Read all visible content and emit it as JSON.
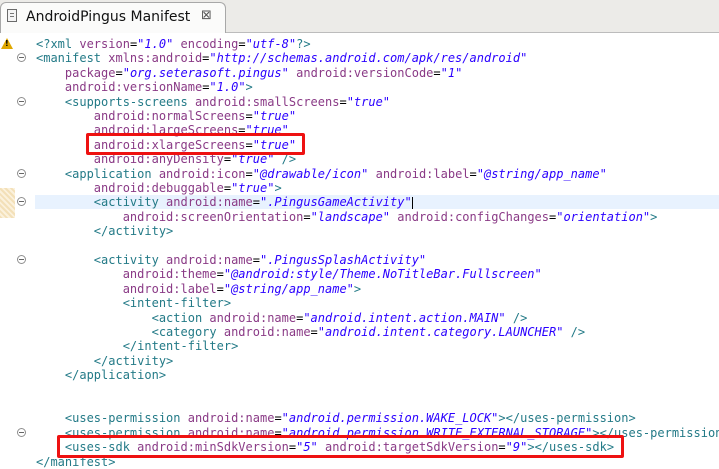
{
  "window": {
    "tab_title": "AndroidPingus Manifest",
    "close_glyph": "⊠"
  },
  "editor": {
    "lines": [
      [
        [
          "pi",
          "<?xml "
        ],
        [
          "attr",
          "version"
        ],
        [
          "eq",
          "="
        ],
        [
          "val",
          "\"1.0\""
        ],
        [
          "pi",
          " "
        ],
        [
          "attr",
          "encoding"
        ],
        [
          "eq",
          "="
        ],
        [
          "val",
          "\"utf-8\""
        ],
        [
          "pi",
          "?>"
        ]
      ],
      [
        [
          "tag",
          "<manifest "
        ],
        [
          "attr",
          "xmlns:android"
        ],
        [
          "eq",
          "="
        ],
        [
          "val",
          "\"http://schemas.android.com/apk/res/android\""
        ]
      ],
      [
        [
          "pad",
          "    "
        ],
        [
          "attr",
          "package"
        ],
        [
          "eq",
          "="
        ],
        [
          "val",
          "\"org.seterasoft.pingus\""
        ],
        [
          "pad",
          " "
        ],
        [
          "attr",
          "android:versionCode"
        ],
        [
          "eq",
          "="
        ],
        [
          "val",
          "\"1\""
        ]
      ],
      [
        [
          "pad",
          "    "
        ],
        [
          "attr",
          "android:versionName"
        ],
        [
          "eq",
          "="
        ],
        [
          "val",
          "\"1.0\""
        ],
        [
          "tag",
          ">"
        ]
      ],
      [
        [
          "pad",
          "    "
        ],
        [
          "tag",
          "<supports-screens "
        ],
        [
          "attr",
          "android:smallScreens"
        ],
        [
          "eq",
          "="
        ],
        [
          "val",
          "\"true\""
        ]
      ],
      [
        [
          "pad",
          "        "
        ],
        [
          "attr",
          "android:normalScreens"
        ],
        [
          "eq",
          "="
        ],
        [
          "val",
          "\"true\""
        ]
      ],
      [
        [
          "pad",
          "        "
        ],
        [
          "attr",
          "android:largeScreens"
        ],
        [
          "eq",
          "="
        ],
        [
          "val",
          "\"true\""
        ]
      ],
      [
        [
          "pad",
          "        "
        ],
        [
          "attr",
          "android:xlargeScreens"
        ],
        [
          "eq",
          "="
        ],
        [
          "val",
          "\"true\""
        ]
      ],
      [
        [
          "pad",
          "        "
        ],
        [
          "attr",
          "android:anyDensity"
        ],
        [
          "eq",
          "="
        ],
        [
          "val",
          "\"true\""
        ],
        [
          "tag",
          " />"
        ]
      ],
      [
        [
          "pad",
          "    "
        ],
        [
          "tag",
          "<application "
        ],
        [
          "attr",
          "android:icon"
        ],
        [
          "eq",
          "="
        ],
        [
          "val",
          "\"@drawable/icon\""
        ],
        [
          "pad",
          " "
        ],
        [
          "attr",
          "android:label"
        ],
        [
          "eq",
          "="
        ],
        [
          "val",
          "\"@string/app_name\""
        ]
      ],
      [
        [
          "pad",
          "        "
        ],
        [
          "attr",
          "android:debuggable"
        ],
        [
          "eq",
          "="
        ],
        [
          "val",
          "\"true\""
        ],
        [
          "tag",
          ">"
        ]
      ],
      [
        [
          "pad",
          "        "
        ],
        [
          "tag",
          "<activity "
        ],
        [
          "attr",
          "android:name"
        ],
        [
          "eq",
          "="
        ],
        [
          "val",
          "\".PingusGameActivity\""
        ]
      ],
      [
        [
          "pad",
          "            "
        ],
        [
          "attr",
          "android:screenOrientation"
        ],
        [
          "eq",
          "="
        ],
        [
          "val",
          "\"landscape\""
        ],
        [
          "pad",
          " "
        ],
        [
          "attr",
          "android:configChanges"
        ],
        [
          "eq",
          "="
        ],
        [
          "val",
          "\"orientation\""
        ],
        [
          "tag",
          ">"
        ]
      ],
      [
        [
          "pad",
          "        "
        ],
        [
          "tag",
          "</activity>"
        ]
      ],
      [],
      [
        [
          "pad",
          "        "
        ],
        [
          "tag",
          "<activity "
        ],
        [
          "attr",
          "android:name"
        ],
        [
          "eq",
          "="
        ],
        [
          "val",
          "\".PingusSplashActivity\""
        ]
      ],
      [
        [
          "pad",
          "            "
        ],
        [
          "attr",
          "android:theme"
        ],
        [
          "eq",
          "="
        ],
        [
          "val",
          "\"@android:style/Theme.NoTitleBar.Fullscreen\""
        ]
      ],
      [
        [
          "pad",
          "            "
        ],
        [
          "attr",
          "android:label"
        ],
        [
          "eq",
          "="
        ],
        [
          "val",
          "\"@string/app_name\""
        ],
        [
          "tag",
          ">"
        ]
      ],
      [
        [
          "pad",
          "            "
        ],
        [
          "tag",
          "<intent-filter>"
        ]
      ],
      [
        [
          "pad",
          "                "
        ],
        [
          "tag",
          "<action "
        ],
        [
          "attr",
          "android:name"
        ],
        [
          "eq",
          "="
        ],
        [
          "val",
          "\"android.intent.action.MAIN\""
        ],
        [
          "tag",
          " />"
        ]
      ],
      [
        [
          "pad",
          "                "
        ],
        [
          "tag",
          "<category "
        ],
        [
          "attr",
          "android:name"
        ],
        [
          "eq",
          "="
        ],
        [
          "val",
          "\"android.intent.category.LAUNCHER\""
        ],
        [
          "tag",
          " />"
        ]
      ],
      [
        [
          "pad",
          "            "
        ],
        [
          "tag",
          "</intent-filter>"
        ]
      ],
      [
        [
          "pad",
          "        "
        ],
        [
          "tag",
          "</activity>"
        ]
      ],
      [
        [
          "pad",
          "    "
        ],
        [
          "tag",
          "</application>"
        ]
      ],
      [],
      [],
      [
        [
          "pad",
          "    "
        ],
        [
          "tag",
          "<uses-permission "
        ],
        [
          "attr",
          "android:name"
        ],
        [
          "eq",
          "="
        ],
        [
          "val",
          "\"android.permission.WAKE_LOCK\""
        ],
        [
          "tag",
          "></uses-permission>"
        ]
      ],
      [
        [
          "pad",
          "    "
        ],
        [
          "tag",
          "<uses-permission "
        ],
        [
          "attr",
          "android:name"
        ],
        [
          "eq",
          "="
        ],
        [
          "val",
          "\"android.permission.WRITE_EXTERNAL_STORAGE\""
        ],
        [
          "tag",
          "></uses-permission>"
        ]
      ],
      [
        [
          "pad",
          "    "
        ],
        [
          "tag",
          "<uses-sdk "
        ],
        [
          "attr",
          "android:minSdkVersion"
        ],
        [
          "eq",
          "="
        ],
        [
          "val",
          "\"5\""
        ],
        [
          "pad",
          " "
        ],
        [
          "attr",
          "android:targetSdkVersion"
        ],
        [
          "eq",
          "="
        ],
        [
          "val",
          "\"9\""
        ],
        [
          "tag",
          "></uses-sdk>"
        ]
      ],
      [
        [
          "tag",
          "</manifest>"
        ]
      ]
    ],
    "highlighted_line": 11,
    "caret_line": 11,
    "folded_lines": [
      1,
      4,
      9,
      11,
      15,
      27
    ],
    "warning_line": 0,
    "annotated_lines": [
      7,
      28
    ]
  },
  "colors": {
    "tag": "#237a87",
    "attribute": "#8a3a86",
    "value": "#2a00ff",
    "annotation_box": "#ee1111",
    "current_line": "#e8f2fe"
  }
}
